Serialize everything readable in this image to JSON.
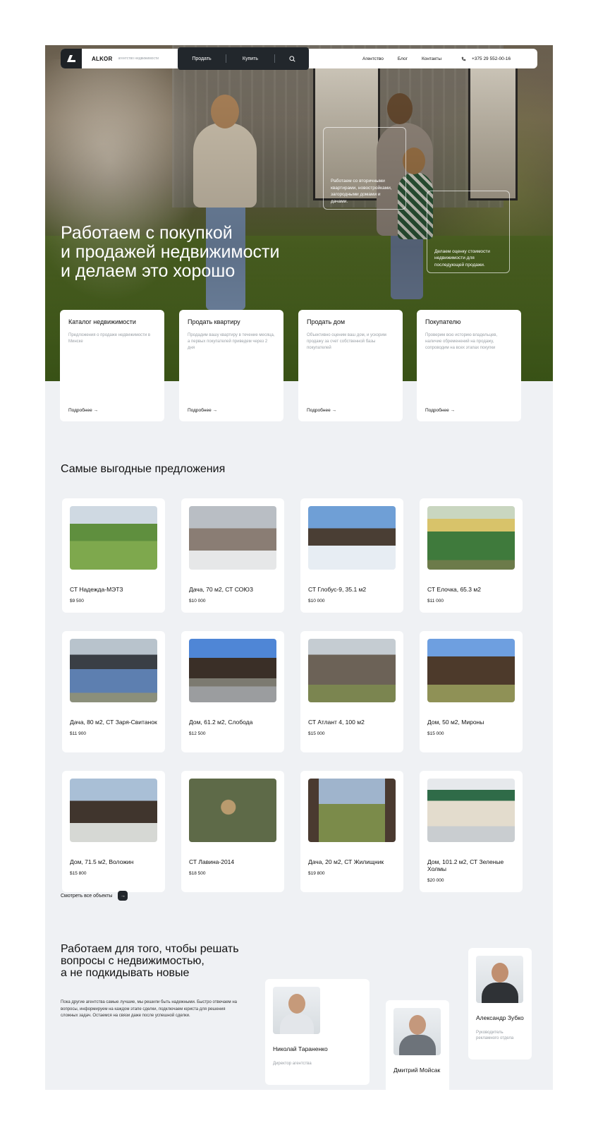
{
  "nav": {
    "brand": "ALKOR",
    "brand_sub": "агентство недвижимости",
    "sell": "Продать",
    "buy": "Купить",
    "links": [
      "Агентство",
      "Блог",
      "Контакты"
    ],
    "phone": "+375 29 552-00-16"
  },
  "hero": {
    "title_lines": [
      "Работаем с покупкой",
      "и продажей недвижимости",
      "и делаем это хорошо"
    ],
    "note1": "Работаем со вторичными квартирами, новостройками, загородными домами и дачами.",
    "note2": "Делаем оценку стоимости недвижимости для последующей продажи."
  },
  "services": [
    {
      "title": "Каталог недвижимости",
      "text": "Предложения о продаже недвижимости в Минске",
      "more": "Подробнее →"
    },
    {
      "title": "Продать квартиру",
      "text": "Продадим вашу квартиру в течение месяца, а первых покупателей приведем через 2 дня",
      "more": "Подробнее →"
    },
    {
      "title": "Продать дом",
      "text": "Объективно оценим ваш дом, и ускорим продажу за счет собственной базы покупателей",
      "more": "Подробнее →"
    },
    {
      "title": "Покупателю",
      "text": "Проверим всю историю владельцев, наличие обременений на продажу, сопроводим на всех этапах покупки",
      "more": "Подробнее →"
    }
  ],
  "offers_title": "Самые выгодные предложения",
  "listings": [
    {
      "name": "СТ Надежда-МЭТЗ",
      "price": "$9 500"
    },
    {
      "name": "Дача, 70 м2, СТ СОЮЗ",
      "price": "$10 000"
    },
    {
      "name": "СТ Глобус-9, 35.1 м2",
      "price": "$10 000"
    },
    {
      "name": "СТ Елочка, 65.3 м2",
      "price": "$11 000"
    },
    {
      "name": "Дача, 80 м2, СТ Заря-Свитанок",
      "price": "$11 900"
    },
    {
      "name": "Дом, 61.2 м2, Слобода",
      "price": "$12 500"
    },
    {
      "name": "СТ Атлант 4, 100 м2",
      "price": "$15 000"
    },
    {
      "name": "Дом, 50 м2, Мироны",
      "price": "$15 000"
    },
    {
      "name": "Дом, 71.5 м2, Воложин",
      "price": "$15 800"
    },
    {
      "name": "СТ Лавина-2014",
      "price": "$18 500"
    },
    {
      "name": "Дача, 20 м2, СТ Жилищник",
      "price": "$19 800"
    },
    {
      "name": "Дом, 101.2 м2, СТ Зеленые Холмы",
      "price": "$20 000"
    }
  ],
  "see_all": "Смотреть все объекты",
  "see_all_arrow": "→",
  "about": {
    "title_lines": [
      "Работаем для того, чтобы решать",
      "вопросы с недвижимостью,",
      "а не подкидывать новые"
    ],
    "text": "Пока другие агентства самые лучшие, мы решили быть надежными. Быстро отвечаем на вопросы, информируем на каждом этапе сделки, подключаем юриста для решения сложных задач. Остаемся на связи даже после успешной сделки."
  },
  "team": [
    {
      "name": "Николай Тараненко",
      "role": "Директор агентства"
    },
    {
      "name": "Дмитрий Мойсак",
      "role": ""
    },
    {
      "name": "Александр Зубко",
      "role": "Руководитель рекламного отдела"
    }
  ],
  "colors": {
    "dark": "#22272c",
    "section_bg": "#eff1f4",
    "muted": "#9aa0a6"
  }
}
